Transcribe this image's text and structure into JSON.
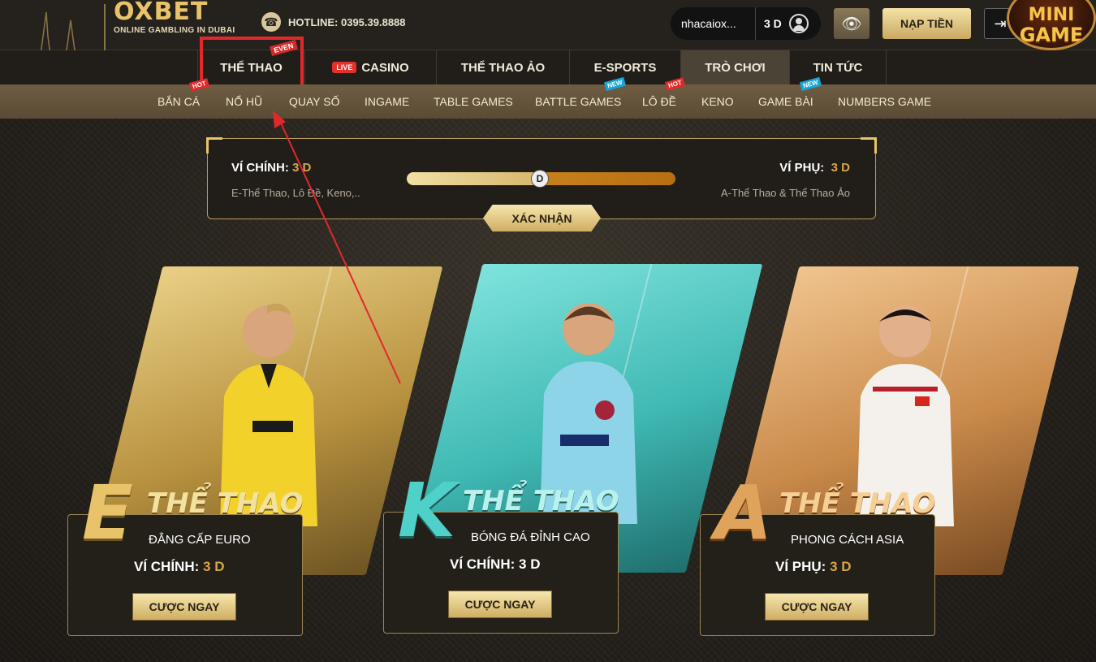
{
  "header": {
    "logo_main": "OXBET",
    "logo_sub": "ONLINE GAMBLING IN DUBAI",
    "hotline": "HOTLINE: 0395.39.8888",
    "username": "nhacaiox...",
    "balance": "3 D",
    "deposit_label": "NẠP TIỀN",
    "mini_game_top": "MINI",
    "mini_game_bottom": "GAME"
  },
  "main_nav": {
    "items": [
      {
        "label": "THỂ THAO",
        "tag": "EVEN"
      },
      {
        "label": "CASINO",
        "badge": "LIVE"
      },
      {
        "label": "THỂ THAO ẢO"
      },
      {
        "label": "E-SPORTS"
      },
      {
        "label": "TRÒ CHƠI"
      },
      {
        "label": "TIN TỨC"
      }
    ]
  },
  "sub_nav": {
    "items": [
      {
        "label": "BẮN CÁ",
        "tag": "HOT"
      },
      {
        "label": "NỔ HŨ"
      },
      {
        "label": "QUAY SỐ"
      },
      {
        "label": "INGAME"
      },
      {
        "label": "TABLE GAMES"
      },
      {
        "label": "BATTLE GAMES",
        "tag": "NEW"
      },
      {
        "label": "LÔ ĐỀ",
        "tag": "HOT"
      },
      {
        "label": "KENO"
      },
      {
        "label": "GAME BÀI",
        "tag": "NEW"
      },
      {
        "label": "NUMBERS GAME"
      }
    ]
  },
  "wallet": {
    "main_label": "VÍ CHÍNH:",
    "main_amount": "3 D",
    "main_desc": "E-Thể Thao, Lô Đề, Keno,..",
    "sub_label": "VÍ PHỤ:",
    "sub_amount": "3 D",
    "sub_desc": "A-Thể Thao & Thể Thao Ảo",
    "knob": "D",
    "confirm_label": "XÁC NHẬN"
  },
  "cards": [
    {
      "letter": "E",
      "title": "THỂ THAO",
      "desc": "ĐẲNG CẤP EURO",
      "wallet_label": "VÍ CHÍNH:",
      "wallet_amount": "3 D",
      "button": "CƯỢC NGAY"
    },
    {
      "letter": "K",
      "title": "THỂ THAO",
      "desc": "BÓNG ĐÁ ĐỈNH CAO",
      "wallet_label": "VÍ CHÍNH:",
      "wallet_amount": "3 D",
      "button": "CƯỢC NGAY"
    },
    {
      "letter": "A",
      "title": "THỂ THAO",
      "desc": "PHONG CÁCH ASIA",
      "wallet_label": "VÍ PHỤ:",
      "wallet_amount": "3 D",
      "button": "CƯỢC NGAY"
    }
  ],
  "colors": {
    "gold": "#e8c36a",
    "highlight_red": "#e3282c",
    "card_e": "#c9a54e",
    "card_k": "#3fb8b3",
    "card_a": "#c98a4a"
  }
}
